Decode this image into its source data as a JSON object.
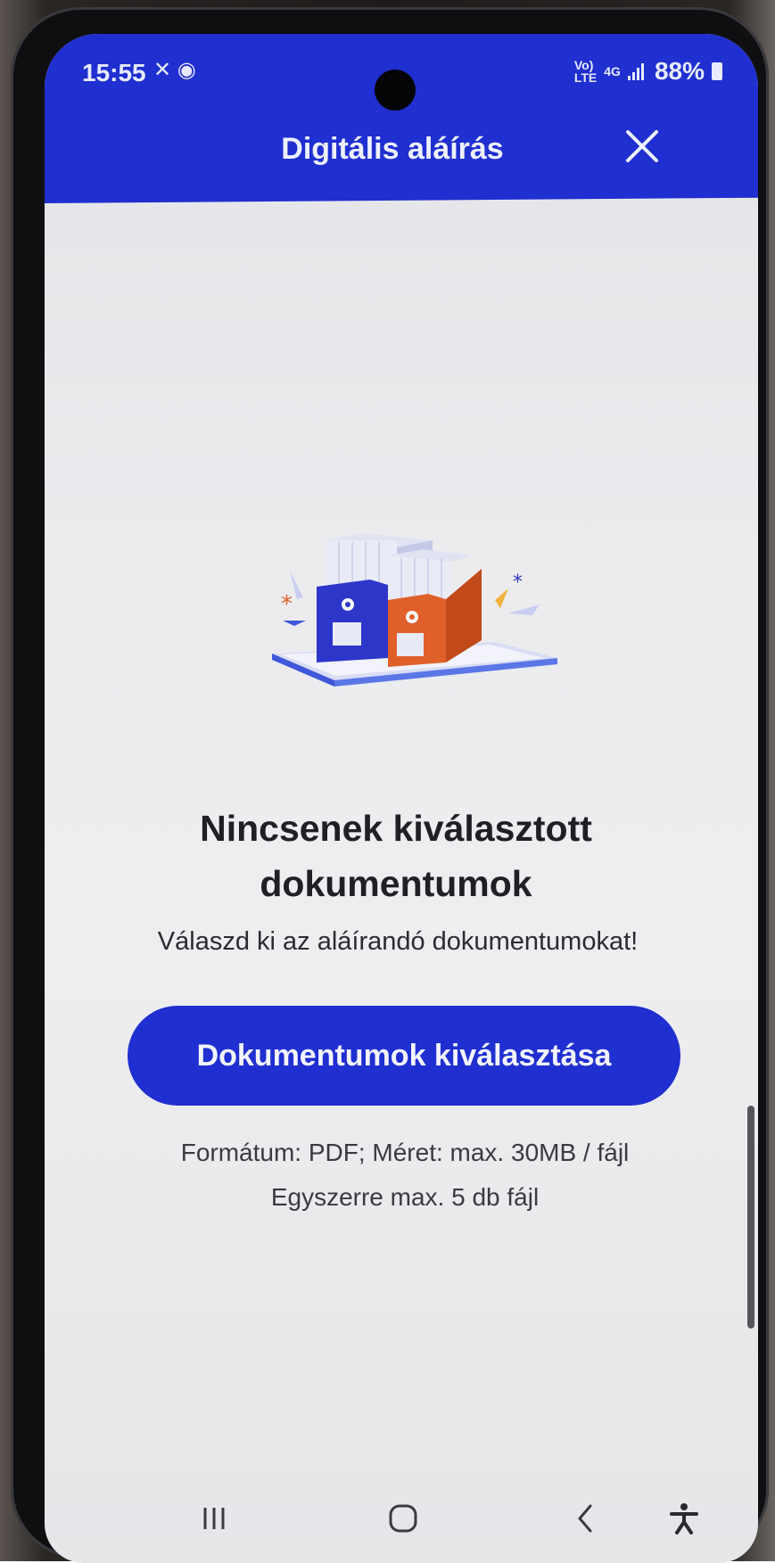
{
  "status_bar": {
    "time": "15:55",
    "left_icons": "✕ ◉",
    "network_label_top": "Vo)",
    "network_label_bottom": "LTE",
    "network_gen": "4G",
    "battery": "88%"
  },
  "header": {
    "title": "Digitális aláírás",
    "close_icon": "close-icon"
  },
  "empty_state": {
    "heading_line1": "Nincsenek kiválasztott",
    "heading_line2": "dokumentumok",
    "subtext": "Válaszd ki az aláírandó dokumentumokat!",
    "illustration": "document-folders-illustration"
  },
  "actions": {
    "select_documents_label": "Dokumentumok kiválasztása"
  },
  "info": {
    "format_line": "Formátum: PDF; Méret: max. 30MB / fájl",
    "limit_line": "Egyszerre max. 5 db fájl"
  },
  "navigation": {
    "recents_icon": "recents-icon",
    "home_icon": "home-icon",
    "back_icon": "back-icon",
    "accessibility_icon": "accessibility-icon"
  },
  "colors": {
    "accent": "#1f2fd0",
    "background": "#ececef",
    "text": "#1f1f24",
    "folder_blue": "#2d36c9",
    "folder_orange": "#e0602a"
  }
}
